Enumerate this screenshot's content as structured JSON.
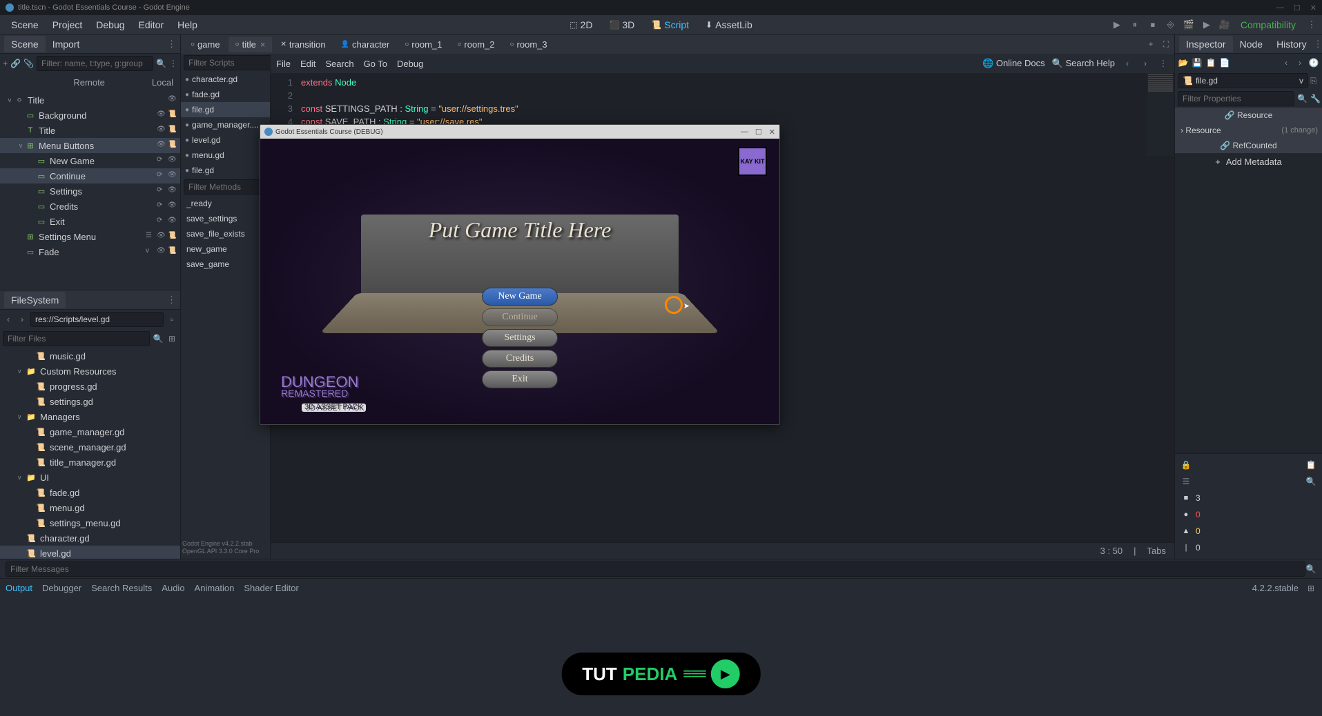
{
  "titlebar": {
    "text": "title.tscn - Godot Essentials Course - Godot Engine"
  },
  "menubar": {
    "items": [
      "Scene",
      "Project",
      "Debug",
      "Editor",
      "Help"
    ]
  },
  "view_switch": {
    "items": [
      {
        "label": "2D",
        "icon": "⬚"
      },
      {
        "label": "3D",
        "icon": "⬛"
      },
      {
        "label": "Script",
        "icon": "📜",
        "active": true
      },
      {
        "label": "AssetLib",
        "icon": "⬇"
      }
    ]
  },
  "renderer": "Compatibility",
  "dock_scene": {
    "tabs": [
      "Scene",
      "Import"
    ],
    "filter_placeholder": "Filter: name, t:type, g:group",
    "buttons": {
      "remote": "Remote",
      "local": "Local"
    }
  },
  "scene_tree": [
    {
      "label": "Title",
      "depth": 0,
      "arrow": "v",
      "icon": "○",
      "iclass": "ic-node",
      "right": [
        "👁"
      ]
    },
    {
      "label": "Background",
      "depth": 1,
      "arrow": "",
      "icon": "▭",
      "iclass": "ic-ctrl",
      "right": [
        "👁",
        "📜"
      ]
    },
    {
      "label": "Title",
      "depth": 1,
      "arrow": "",
      "icon": "T",
      "iclass": "ic-ctrl",
      "right": [
        "👁",
        "📜"
      ]
    },
    {
      "label": "Menu Buttons",
      "depth": 1,
      "arrow": "v",
      "icon": "⊞",
      "iclass": "ic-ctrl",
      "right": [
        "👁",
        "📜"
      ],
      "selected": true
    },
    {
      "label": "New Game",
      "depth": 2,
      "arrow": "",
      "icon": "▭",
      "iclass": "ic-btn",
      "right": [
        "⟳",
        "👁"
      ]
    },
    {
      "label": "Continue",
      "depth": 2,
      "arrow": "",
      "icon": "▭",
      "iclass": "ic-btn",
      "right": [
        "⟳",
        "👁"
      ],
      "selected": true
    },
    {
      "label": "Settings",
      "depth": 2,
      "arrow": "",
      "icon": "▭",
      "iclass": "ic-btn",
      "right": [
        "⟳",
        "👁"
      ]
    },
    {
      "label": "Credits",
      "depth": 2,
      "arrow": "",
      "icon": "▭",
      "iclass": "ic-btn",
      "right": [
        "⟳",
        "👁"
      ]
    },
    {
      "label": "Exit",
      "depth": 2,
      "arrow": "",
      "icon": "▭",
      "iclass": "ic-btn",
      "right": [
        "⟳",
        "👁"
      ]
    },
    {
      "label": "Settings Menu",
      "depth": 1,
      "arrow": "",
      "icon": "⊞",
      "iclass": "ic-ctrl",
      "right": [
        "☰",
        "👁",
        "📜"
      ]
    },
    {
      "label": "Fade",
      "depth": 1,
      "arrow": "",
      "icon": "▭",
      "iclass": "ic-color",
      "right": [
        "v",
        "👁",
        "📜"
      ]
    }
  ],
  "filesystem": {
    "title": "FileSystem",
    "path": "res://Scripts/level.gd",
    "filter_placeholder": "Filter Files"
  },
  "fs_tree": [
    {
      "label": "music.gd",
      "type": "file",
      "depth": 2
    },
    {
      "label": "Custom Resources",
      "type": "folder",
      "depth": 1,
      "arrow": "v"
    },
    {
      "label": "progress.gd",
      "type": "file",
      "depth": 2
    },
    {
      "label": "settings.gd",
      "type": "file",
      "depth": 2
    },
    {
      "label": "Managers",
      "type": "folder",
      "depth": 1,
      "arrow": "v"
    },
    {
      "label": "game_manager.gd",
      "type": "file",
      "depth": 2
    },
    {
      "label": "scene_manager.gd",
      "type": "file",
      "depth": 2
    },
    {
      "label": "title_manager.gd",
      "type": "file",
      "depth": 2
    },
    {
      "label": "UI",
      "type": "folder",
      "depth": 1,
      "arrow": "v"
    },
    {
      "label": "fade.gd",
      "type": "file",
      "depth": 2
    },
    {
      "label": "menu.gd",
      "type": "file",
      "depth": 2
    },
    {
      "label": "settings_menu.gd",
      "type": "file",
      "depth": 2
    },
    {
      "label": "character.gd",
      "type": "file",
      "depth": 1
    },
    {
      "label": "level.gd",
      "type": "file",
      "depth": 1,
      "selected": true
    }
  ],
  "scene_tabs": [
    {
      "label": "game",
      "icon": "○"
    },
    {
      "label": "title",
      "icon": "○",
      "active": true,
      "close": true
    },
    {
      "label": "transition",
      "icon": "✕"
    },
    {
      "label": "character",
      "icon": "👤"
    },
    {
      "label": "room_1",
      "icon": "○"
    },
    {
      "label": "room_2",
      "icon": "○"
    },
    {
      "label": "room_3",
      "icon": "○"
    }
  ],
  "script_menu": [
    "File",
    "Edit",
    "Search",
    "Go To",
    "Debug"
  ],
  "script_help": {
    "docs": "Online Docs",
    "search": "Search Help"
  },
  "script_filter_placeholder": "Filter Scripts",
  "script_list": [
    {
      "label": "character.gd"
    },
    {
      "label": "fade.gd"
    },
    {
      "label": "file.gd",
      "active": true
    },
    {
      "label": "game_manager...."
    },
    {
      "label": "level.gd"
    },
    {
      "label": "menu.gd"
    },
    {
      "label": "file.gd"
    }
  ],
  "method_filter_placeholder": "Filter Methods",
  "method_list": [
    "_ready",
    "save_settings",
    "save_file_exists",
    "new_game",
    "save_game"
  ],
  "engine_info": {
    "line1": "Godot Engine v4.2.2.stab",
    "line2": "OpenGL API 3.3.0 Core Pro"
  },
  "code_lines": [
    {
      "n": 1,
      "parts": [
        {
          "t": "extends ",
          "c": "kw-red"
        },
        {
          "t": "Node",
          "c": "kw-cyan"
        }
      ]
    },
    {
      "n": 2,
      "parts": []
    },
    {
      "n": 3,
      "parts": [
        {
          "t": "const ",
          "c": "kw-red"
        },
        {
          "t": "SETTINGS_PATH ",
          "c": ""
        },
        {
          "t": ": ",
          "c": ""
        },
        {
          "t": "String ",
          "c": "kw-cyan"
        },
        {
          "t": "= ",
          "c": ""
        },
        {
          "t": "\"user://settings.tres\"",
          "c": "kw-orange"
        }
      ]
    },
    {
      "n": 4,
      "parts": [
        {
          "t": "const ",
          "c": "kw-red"
        },
        {
          "t": "SAVE_PATH ",
          "c": ""
        },
        {
          "t": ": ",
          "c": ""
        },
        {
          "t": "String ",
          "c": "kw-cyan"
        },
        {
          "t": "= ",
          "c": ""
        },
        {
          "t": "\"user://save.res\"",
          "c": "kw-orange"
        }
      ]
    }
  ],
  "status": {
    "line": "3",
    "col": "50",
    "indent": "Tabs"
  },
  "game_window": {
    "title": "Godot Essentials Course (DEBUG)",
    "game_title": "Put Game Title Here",
    "buttons": [
      "New Game",
      "Continue",
      "Settings",
      "Credits",
      "Exit"
    ],
    "logo": {
      "main": "DUNGEON",
      "sub1": "REMASTERED",
      "sub2": "3D ASSET PACK"
    },
    "badge": "KAY\nKIT"
  },
  "inspector": {
    "tabs": [
      "Inspector",
      "Node",
      "History"
    ],
    "resource": "file.gd",
    "filter_placeholder": "Filter Properties",
    "sections": {
      "resource_h": "Resource",
      "resource_r": "Resource",
      "change": "(1 change)",
      "refcounted": "RefCounted",
      "add_meta": "Add Metadata"
    }
  },
  "right_counters": [
    {
      "icon": "■",
      "value": "3",
      "class": ""
    },
    {
      "icon": "●",
      "value": "0",
      "class": "red"
    },
    {
      "icon": "▲",
      "value": "0",
      "class": "yellow"
    },
    {
      "icon": "|",
      "value": "0",
      "class": ""
    }
  ],
  "bottom": {
    "filter_placeholder": "Filter Messages",
    "tabs": [
      "Output",
      "Debugger",
      "Search Results",
      "Audio",
      "Animation",
      "Shader Editor"
    ],
    "version": "4.2.2.stable"
  },
  "watermark": {
    "a": "TUT",
    "b": "PEDIA"
  }
}
